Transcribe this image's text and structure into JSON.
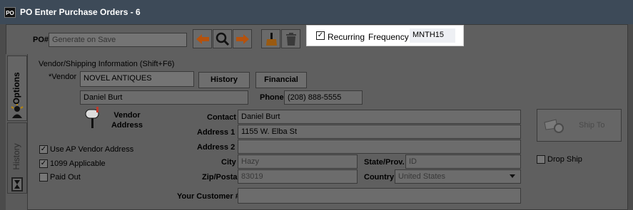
{
  "window": {
    "title": "PO Enter Purchase Orders - 6",
    "app_icon_label": "PO"
  },
  "toolbar": {
    "po_label": "PO#",
    "po_value": "Generate on Save",
    "recurring_label": "Recurring",
    "recurring_checked": true,
    "frequency_label": "Frequency",
    "frequency_value": "MNTH15"
  },
  "side_tabs": {
    "options": "Options",
    "history": "History"
  },
  "vendor": {
    "section_title": "Vendor/Shipping Information (Shift+F6)",
    "vendor_label": "*Vendor",
    "vendor_value": "NOVEL ANTIQUES",
    "history_button": "History",
    "financial_button": "Financial",
    "contact_name": "Daniel Burt",
    "phone_label": "Phone",
    "phone_value": "(208) 888-5555",
    "vendor_address_label": "Vendor Address"
  },
  "address": {
    "contact_label": "Contact",
    "contact_value": "Daniel Burt",
    "address1_label": "Address 1",
    "address1_value": "1155 W. Elba St",
    "address2_label": "Address 2",
    "address2_value": "",
    "city_label": "City",
    "city_value": "Hazy",
    "state_label": "State/Prov.",
    "state_value": "ID",
    "zip_label": "Zip/Postal",
    "zip_value": "83019",
    "country_label": "Country",
    "country_value": "United States",
    "customer_label": "Your Customer #",
    "customer_value": ""
  },
  "options": {
    "use_ap_vendor_address": "Use AP Vendor Address",
    "use_ap_checked": true,
    "applicable_1099": "1099 Applicable",
    "applicable_1099_checked": true,
    "paid_out": "Paid Out",
    "paid_out_checked": false
  },
  "shipping": {
    "ship_to_button": "Ship To",
    "drop_ship_label": "Drop Ship",
    "drop_ship_checked": false
  }
}
